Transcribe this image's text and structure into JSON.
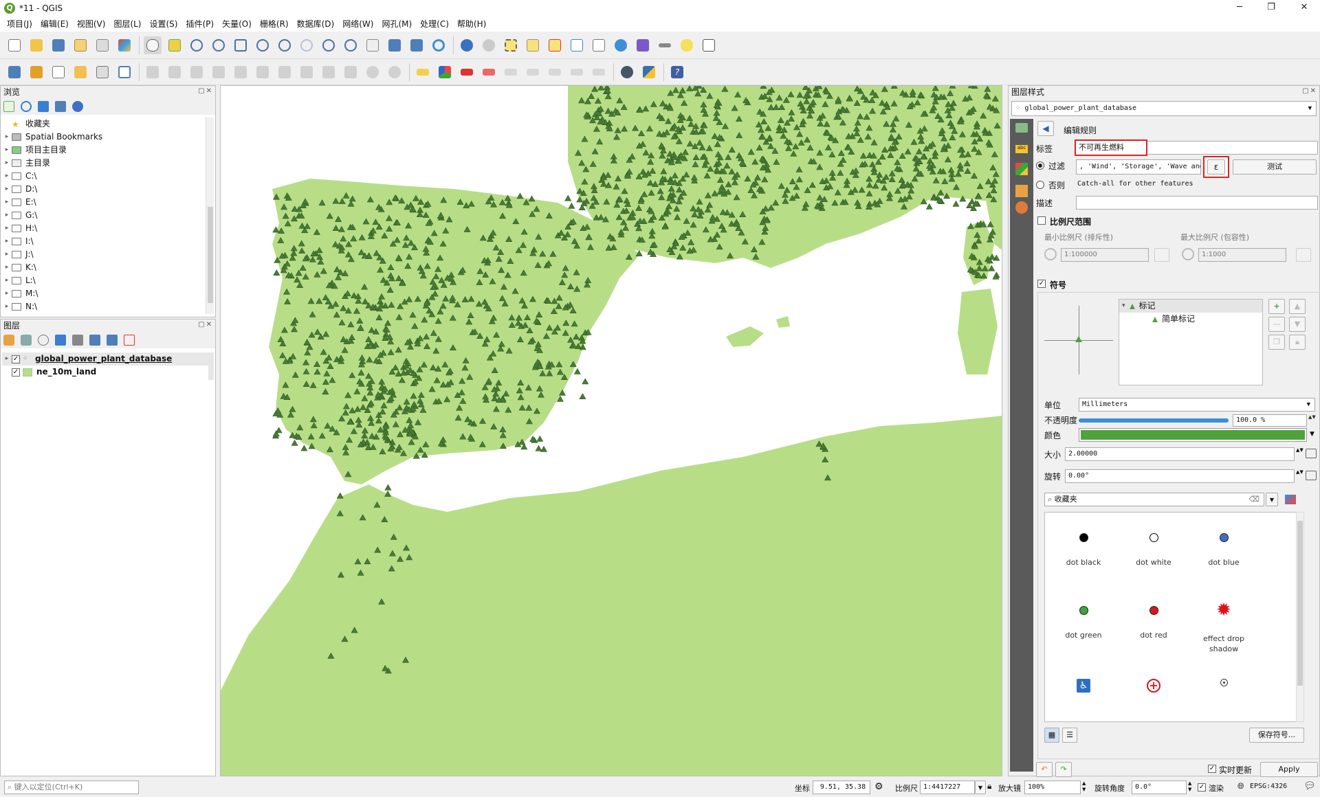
{
  "window": {
    "title": "*11 - QGIS",
    "controls": [
      "─",
      "❐",
      "✕"
    ]
  },
  "menubar": [
    "项目(J)",
    "编辑(E)",
    "视图(V)",
    "图层(L)",
    "设置(S)",
    "插件(P)",
    "矢量(O)",
    "栅格(R)",
    "数据库(D)",
    "网络(W)",
    "网孔(M)",
    "处理(C)",
    "帮助(H)"
  ],
  "browser": {
    "title": "浏览",
    "items": [
      {
        "label": "收藏夹",
        "icon": "star-icon",
        "expand": ""
      },
      {
        "label": "Spatial Bookmarks",
        "icon": "bookmark-icon",
        "expand": "▸"
      },
      {
        "label": "项目主目录",
        "icon": "folder-icon",
        "expand": "▸"
      },
      {
        "label": "主目录",
        "icon": "home-icon",
        "expand": "▸"
      },
      {
        "label": "C:\\",
        "icon": "folder-icon",
        "expand": "▸"
      },
      {
        "label": "D:\\",
        "icon": "folder-icon",
        "expand": "▸"
      },
      {
        "label": "E:\\",
        "icon": "folder-icon",
        "expand": "▸"
      },
      {
        "label": "G:\\",
        "icon": "folder-icon",
        "expand": "▸"
      },
      {
        "label": "H:\\",
        "icon": "folder-icon",
        "expand": "▸"
      },
      {
        "label": "I:\\",
        "icon": "folder-icon",
        "expand": "▸"
      },
      {
        "label": "J:\\",
        "icon": "folder-icon",
        "expand": "▸"
      },
      {
        "label": "K:\\",
        "icon": "folder-icon",
        "expand": "▸"
      },
      {
        "label": "L:\\",
        "icon": "folder-icon",
        "expand": "▸"
      },
      {
        "label": "M:\\",
        "icon": "folder-icon",
        "expand": "▸"
      },
      {
        "label": "N:\\",
        "icon": "folder-icon",
        "expand": "▸"
      }
    ]
  },
  "layers": {
    "title": "图层",
    "items": [
      {
        "name": "global_power_plant_database",
        "checked": true,
        "bold_underline": true
      },
      {
        "name": "ne_10m_land",
        "checked": true,
        "bold_underline": false
      }
    ]
  },
  "style_panel": {
    "title": "图层样式",
    "layer_select": "global_power_plant_database",
    "edit_rule_title": "编辑规则",
    "label_caption": "标签",
    "label_value": "不可再生燃料",
    "filter_caption": "过滤",
    "filter_value": ", 'Wind', 'Storage', 'Wave and Tidal')",
    "expr_button": "ε",
    "test_button": "测试",
    "else_caption": "否则",
    "else_text": "Catch-all for other features",
    "desc_caption": "描述",
    "scale_caption": "比例尺范围",
    "min_scale_caption": "最小比例尺 (排斥性)",
    "max_scale_caption": "最大比例尺 (包容性)",
    "min_scale_value": "1:100000",
    "max_scale_value": "1:1000",
    "symbol_caption": "符号",
    "symbol_tree": [
      "标记",
      "简单标记"
    ],
    "unit_caption": "单位",
    "unit_value": "Millimeters",
    "opacity_caption": "不透明度",
    "opacity_value": "100.0 %",
    "opacity_fraction": 1.0,
    "color_caption": "颜色",
    "color_value": "#4fa23e",
    "size_caption": "大小",
    "size_value": "2.00000",
    "rotation_caption": "旋转",
    "rotation_value": "0.00°",
    "library_search": "收藏夹",
    "symbols": [
      {
        "label": "dot  black",
        "kind": "dot",
        "color": "#000000"
      },
      {
        "label": "dot  white",
        "kind": "dot-outline",
        "color": "#ffffff"
      },
      {
        "label": "dot blue",
        "kind": "dot",
        "color": "#3f6fc2"
      },
      {
        "label": "dot green",
        "kind": "dot",
        "color": "#3fa43a"
      },
      {
        "label": "dot red",
        "kind": "dot",
        "color": "#d7191c"
      },
      {
        "label": "effect drop\nshadow",
        "kind": "star",
        "color": "#e0101a"
      },
      {
        "label": "",
        "kind": "accessible",
        "color": "#2f6fc2"
      },
      {
        "label": "",
        "kind": "cross",
        "color": "#d7191c"
      },
      {
        "label": "",
        "kind": "target",
        "color": "#333333"
      }
    ],
    "save_symbol_button": "保存符号...",
    "live_update_caption": "实时更新",
    "apply_button": "Apply"
  },
  "statusbar": {
    "locator_placeholder": "键入以定位(Ctrl+K)",
    "coord_caption": "坐标",
    "coord_value": "9.51, 35.38",
    "scale_caption": "比例尺",
    "scale_value": "1:4417227",
    "magnifier_caption": "放大镜",
    "magnifier_value": "100%",
    "rotation_caption": "旋转角度",
    "rotation_value": "0.0°",
    "render_caption": "渲染",
    "crs_value": "EPSG:4326"
  },
  "map_colors": {
    "land": "#b7de87",
    "sea": "#ffffff",
    "marker": "#4a7b34"
  }
}
